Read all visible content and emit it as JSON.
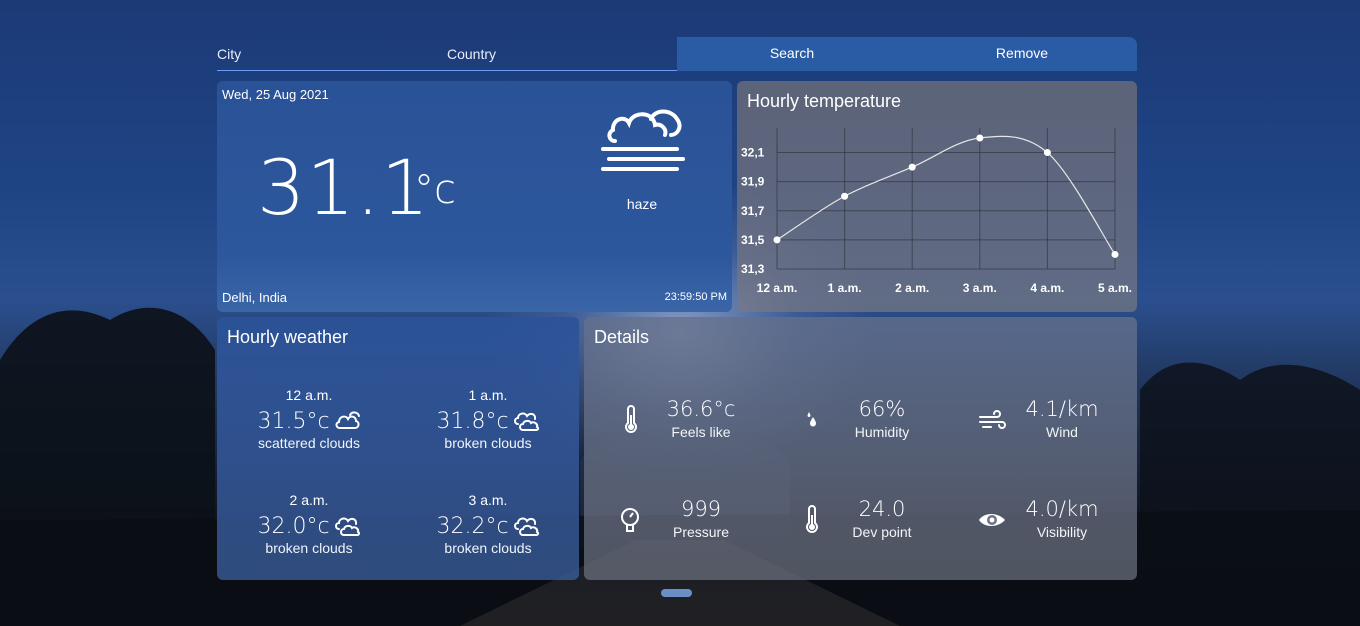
{
  "search": {
    "city_placeholder": "City",
    "country_placeholder": "Country",
    "search_label": "Search",
    "remove_label": "Remove"
  },
  "current": {
    "date": "Wed, 25 Aug 2021",
    "temperature": "31.1",
    "unit": "°c",
    "condition": "haze",
    "location": "Delhi, India",
    "time": "23:59:50 PM",
    "icon": "haze-icon"
  },
  "chart_title": "Hourly temperature",
  "chart_data": {
    "type": "line",
    "categories": [
      "12 a.m.",
      "1 a.m.",
      "2 a.m.",
      "3 a.m.",
      "4 a.m.",
      "5 a.m."
    ],
    "values": [
      31.5,
      31.8,
      32.0,
      32.2,
      32.1,
      31.4
    ],
    "ylim": [
      31.3,
      32.2
    ],
    "yticks": [
      "32,1",
      "31,9",
      "31,7",
      "31,5",
      "31,3"
    ],
    "ytick_values": [
      32.1,
      31.9,
      31.7,
      31.5,
      31.3
    ],
    "grid": true,
    "line_color": "#e6e6e6"
  },
  "hourly": {
    "title": "Hourly weather",
    "items": [
      {
        "time": "12 a.m.",
        "temp": "31.5",
        "unit": "°c",
        "desc": "scattered clouds",
        "icon": "scattered-clouds-icon"
      },
      {
        "time": "1 a.m.",
        "temp": "31.8",
        "unit": "°c",
        "desc": "broken clouds",
        "icon": "broken-clouds-icon"
      },
      {
        "time": "2 a.m.",
        "temp": "32.0",
        "unit": "°c",
        "desc": "broken clouds",
        "icon": "broken-clouds-icon"
      },
      {
        "time": "3 a.m.",
        "temp": "32.2",
        "unit": "°c",
        "desc": "broken clouds",
        "icon": "broken-clouds-icon"
      }
    ]
  },
  "details": {
    "title": "Details",
    "items": [
      {
        "value": "36.6°c",
        "label": "Feels like",
        "icon": "thermometer-icon"
      },
      {
        "value": "66%",
        "label": "Humidity",
        "icon": "humidity-icon"
      },
      {
        "value": "4.1/km",
        "label": "Wind",
        "icon": "wind-icon"
      },
      {
        "value": "999",
        "label": "Pressure",
        "icon": "pressure-icon"
      },
      {
        "value": "24.0",
        "label": "Dev point",
        "icon": "thermometer-icon"
      },
      {
        "value": "4.0/km",
        "label": "Visibility",
        "icon": "eye-icon"
      }
    ]
  },
  "colors": {
    "accent": "#2a5ba5",
    "underline": "#6d9ef5"
  }
}
